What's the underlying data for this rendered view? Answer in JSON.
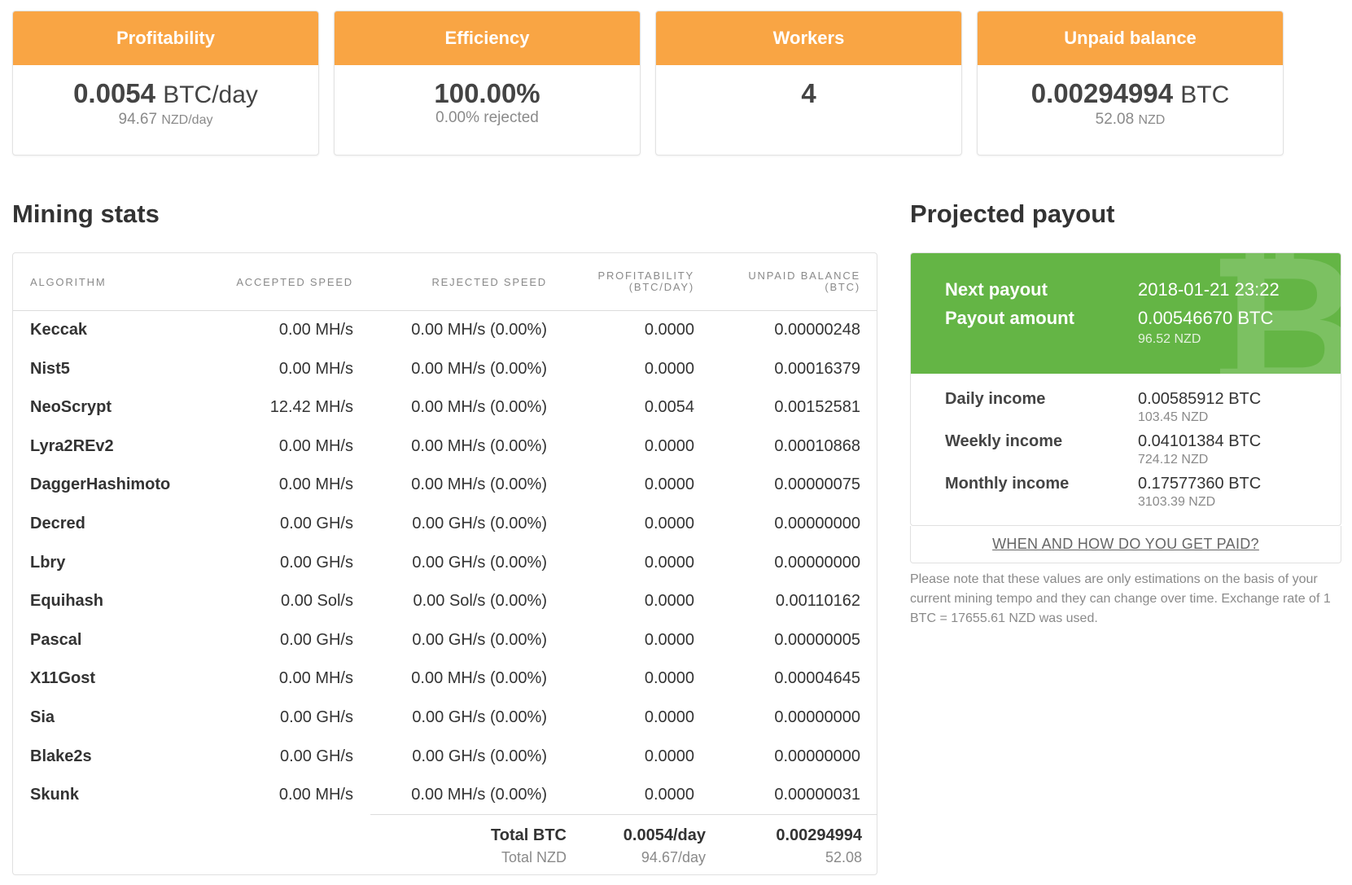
{
  "cards": {
    "profitability": {
      "title": "Profitability",
      "value": "0.0054",
      "unit": "BTC/day",
      "sub_value": "94.67",
      "sub_unit": "NZD/day"
    },
    "efficiency": {
      "title": "Efficiency",
      "value": "100.00%",
      "sub_value": "0.00% rejected"
    },
    "workers": {
      "title": "Workers",
      "value": "4"
    },
    "unpaid": {
      "title": "Unpaid balance",
      "value": "0.00294994",
      "unit": "BTC",
      "sub_value": "52.08",
      "sub_unit": "NZD"
    }
  },
  "mining": {
    "title": "Mining stats",
    "headers": {
      "algorithm": "ALGORITHM",
      "accepted": "ACCEPTED SPEED",
      "rejected": "REJECTED SPEED",
      "profitability_1": "PROFITABILITY",
      "profitability_2": "(BTC/DAY)",
      "unpaid_1": "UNPAID BALANCE",
      "unpaid_2": "(BTC)"
    },
    "rows": [
      {
        "algorithm": "Keccak",
        "accepted": "0.00 MH/s",
        "rejected": "0.00 MH/s (0.00%)",
        "profitability": "0.0000",
        "unpaid": "0.00000248"
      },
      {
        "algorithm": "Nist5",
        "accepted": "0.00 MH/s",
        "rejected": "0.00 MH/s (0.00%)",
        "profitability": "0.0000",
        "unpaid": "0.00016379"
      },
      {
        "algorithm": "NeoScrypt",
        "accepted": "12.42 MH/s",
        "rejected": "0.00 MH/s (0.00%)",
        "profitability": "0.0054",
        "unpaid": "0.00152581"
      },
      {
        "algorithm": "Lyra2REv2",
        "accepted": "0.00 MH/s",
        "rejected": "0.00 MH/s (0.00%)",
        "profitability": "0.0000",
        "unpaid": "0.00010868"
      },
      {
        "algorithm": "DaggerHashimoto",
        "accepted": "0.00 MH/s",
        "rejected": "0.00 MH/s (0.00%)",
        "profitability": "0.0000",
        "unpaid": "0.00000075"
      },
      {
        "algorithm": "Decred",
        "accepted": "0.00 GH/s",
        "rejected": "0.00 GH/s (0.00%)",
        "profitability": "0.0000",
        "unpaid": "0.00000000"
      },
      {
        "algorithm": "Lbry",
        "accepted": "0.00 GH/s",
        "rejected": "0.00 GH/s (0.00%)",
        "profitability": "0.0000",
        "unpaid": "0.00000000"
      },
      {
        "algorithm": "Equihash",
        "accepted": "0.00 Sol/s",
        "rejected": "0.00 Sol/s (0.00%)",
        "profitability": "0.0000",
        "unpaid": "0.00110162"
      },
      {
        "algorithm": "Pascal",
        "accepted": "0.00 GH/s",
        "rejected": "0.00 GH/s (0.00%)",
        "profitability": "0.0000",
        "unpaid": "0.00000005"
      },
      {
        "algorithm": "X11Gost",
        "accepted": "0.00 MH/s",
        "rejected": "0.00 MH/s (0.00%)",
        "profitability": "0.0000",
        "unpaid": "0.00004645"
      },
      {
        "algorithm": "Sia",
        "accepted": "0.00 GH/s",
        "rejected": "0.00 GH/s (0.00%)",
        "profitability": "0.0000",
        "unpaid": "0.00000000"
      },
      {
        "algorithm": "Blake2s",
        "accepted": "0.00 GH/s",
        "rejected": "0.00 GH/s (0.00%)",
        "profitability": "0.0000",
        "unpaid": "0.00000000"
      },
      {
        "algorithm": "Skunk",
        "accepted": "0.00 MH/s",
        "rejected": "0.00 MH/s (0.00%)",
        "profitability": "0.0000",
        "unpaid": "0.00000031"
      }
    ],
    "totals": {
      "btc_label": "Total BTC",
      "btc_profitability": "0.0054/day",
      "btc_unpaid": "0.00294994",
      "nzd_label": "Total NZD",
      "nzd_profitability": "94.67/day",
      "nzd_unpaid": "52.08"
    }
  },
  "payout": {
    "title": "Projected payout",
    "next_payout_label": "Next payout",
    "next_payout_value": "2018-01-21 23:22",
    "payout_amount_label": "Payout amount",
    "payout_amount_value": "0.00546670 BTC",
    "payout_amount_nzd": "96.52 NZD",
    "watermark_icon": "bitcoin-icon",
    "income": [
      {
        "label": "Daily income",
        "btc": "0.00585912 BTC",
        "nzd": "103.45 NZD"
      },
      {
        "label": "Weekly income",
        "btc": "0.04101384 BTC",
        "nzd": "724.12 NZD"
      },
      {
        "label": "Monthly income",
        "btc": "0.17577360 BTC",
        "nzd": "3103.39 NZD"
      }
    ],
    "link": "WHEN AND HOW DO YOU GET PAID?",
    "note": "Please note that these values are only estimations on the basis of your current mining tempo and they can change over time. Exchange rate of 1 BTC = 17655.61 NZD was used."
  },
  "colors": {
    "orange": "#f9a544",
    "green": "#64b545",
    "text": "#333333",
    "muted": "#8a8a8a"
  }
}
